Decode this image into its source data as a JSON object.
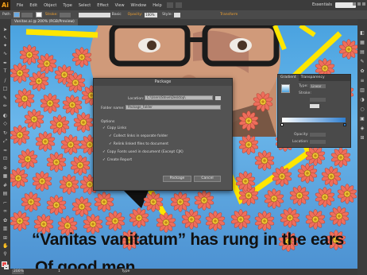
{
  "app": {
    "logo": "Ai",
    "menu": [
      "File",
      "Edit",
      "Object",
      "Type",
      "Select",
      "Effect",
      "View",
      "Window",
      "Help"
    ],
    "workspace": "Essentials"
  },
  "controlbar": {
    "object_type": "Path",
    "stroke_label": "Stroke:",
    "stroke_style": "Basic",
    "opacity_label": "Opacity:",
    "opacity_value": "100%",
    "style_label": "Style:",
    "transform_label": "Transform"
  },
  "document": {
    "tab_title": "Vanitas.ai @ 200% (RGB/Preview)"
  },
  "dialog": {
    "title": "Package",
    "location_label": "Location:",
    "location_value": "C:\\Users\\Steve\\Desktop\\",
    "folder_name_label": "Folder name:",
    "folder_name_value": "Package_Folder",
    "options_label": "Options",
    "options": [
      {
        "label": "Copy Links",
        "checked": true
      },
      {
        "label": "Collect links in separate folder",
        "checked": true
      },
      {
        "label": "Relink linked files to document",
        "checked": true
      },
      {
        "label": "Copy Fonts used in document (Except CJK)",
        "checked": true
      },
      {
        "label": "Create Report",
        "checked": true
      }
    ],
    "package_button": "Package",
    "cancel_button": "Cancel"
  },
  "gradient_panel": {
    "tabs": [
      "Gradient",
      "Transparency"
    ],
    "type_label": "Type:",
    "type_value": "Linear",
    "stroke_label": "Stroke:",
    "opacity_label": "Opacity:",
    "location_label": "Location:"
  },
  "artwork": {
    "line1": "“Vanitas vanitatum” has rung in the ears",
    "line2": "Of good men"
  },
  "statusbar": {
    "zoom": "200%",
    "page": "1",
    "tool": "Type"
  }
}
